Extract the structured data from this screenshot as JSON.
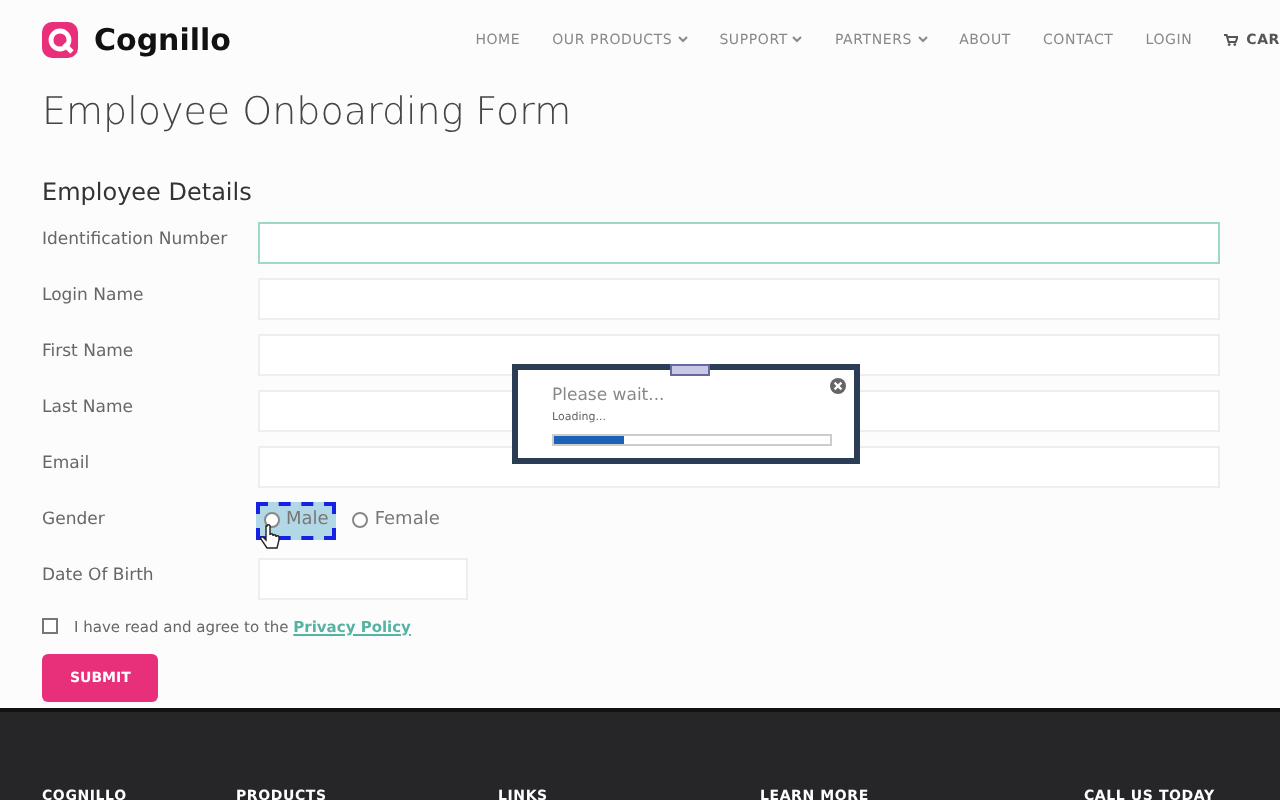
{
  "brand": {
    "name": "Cognillo"
  },
  "nav": [
    {
      "label": "HOME",
      "dropdown": false
    },
    {
      "label": "OUR PRODUCTS",
      "dropdown": true
    },
    {
      "label": "SUPPORT",
      "dropdown": true
    },
    {
      "label": "PARTNERS",
      "dropdown": true
    },
    {
      "label": "ABOUT",
      "dropdown": false
    },
    {
      "label": "CONTACT",
      "dropdown": false
    },
    {
      "label": "LOGIN",
      "dropdown": false
    }
  ],
  "cart": {
    "label": "CAR"
  },
  "page_title": "Employee Onboarding Form",
  "section_title": "Employee Details",
  "fields": [
    {
      "kind": "text",
      "label": "Identification Number",
      "highlighted": true
    },
    {
      "kind": "text",
      "label": "Login Name",
      "highlighted": false
    },
    {
      "kind": "text",
      "label": "First Name",
      "highlighted": false
    },
    {
      "kind": "text",
      "label": "Last Name",
      "highlighted": false
    },
    {
      "kind": "text",
      "label": "Email",
      "highlighted": false
    },
    {
      "kind": "radio",
      "label": "Gender",
      "options": [
        {
          "label": "Male",
          "checked": false,
          "focused": true
        },
        {
          "label": "Female",
          "checked": false,
          "focused": false
        }
      ]
    },
    {
      "kind": "date",
      "label": "Date Of Birth",
      "highlighted": false
    }
  ],
  "agreement": {
    "text": "I have read and agree to the",
    "link": "Privacy Policy",
    "checked": false
  },
  "submit": "SUBMIT",
  "dialog": {
    "title": "Please wait...",
    "message": "Loading...",
    "level": 0.25
  },
  "footer": [
    "COGNILLO",
    "PRODUCTS",
    "LINKS",
    "LEARN MORE",
    "CALL US TODAY"
  ]
}
